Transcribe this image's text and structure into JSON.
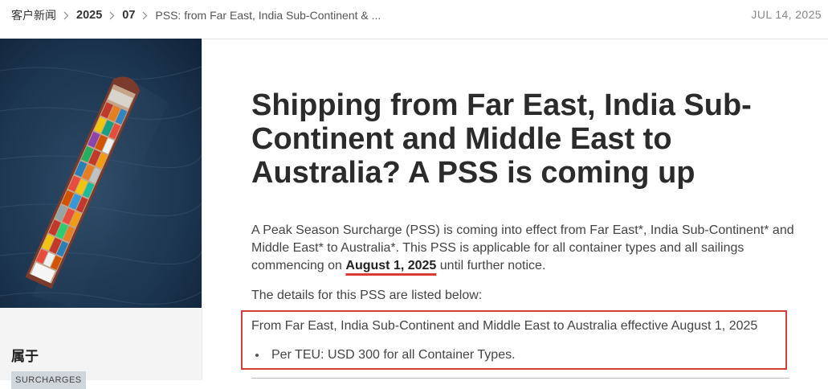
{
  "breadcrumb": {
    "items": [
      "客户新闻",
      "2025",
      "07",
      "PSS: from Far East, India Sub-Continent & ..."
    ]
  },
  "header": {
    "date": "JUL 14, 2025"
  },
  "sidebar": {
    "image_alt": "container-ship-aerial-photo",
    "belongs_label": "属于",
    "tag": "SURCHARGES"
  },
  "article": {
    "title": "Shipping from Far East, India Sub-Continent and Middle East to Australia? A PSS is coming up",
    "intro_before": "A Peak Season Surcharge (PSS) is coming into effect from Far East*, India Sub-Continent* and Middle East* to Australia*. This PSS is applicable for all container types and all sailings commencing on ",
    "intro_date": "August 1, 2025",
    "intro_after": " until further notice.",
    "details_intro": "The details for this PSS are listed below:",
    "highlight_heading": "From Far East, India Sub-Continent and Middle East to Australia effective August 1, 2025",
    "bullets": [
      "Per TEU: USD 300 for all Container Types."
    ]
  },
  "colors": {
    "highlight_border": "#d93a3a",
    "tag_bg": "#cfd6dc"
  }
}
